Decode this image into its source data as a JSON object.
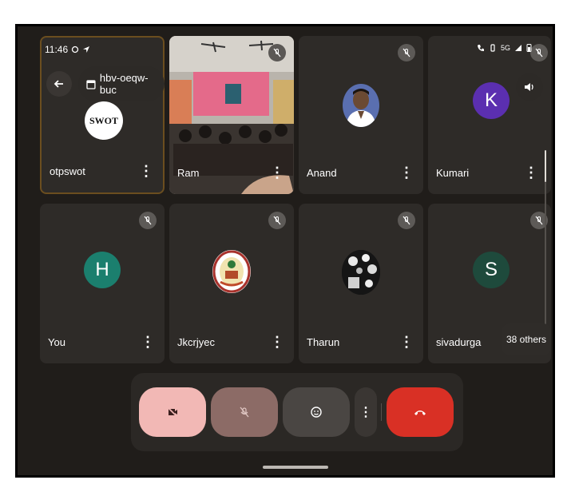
{
  "status_bar": {
    "time": "11:46",
    "icons": [
      "sync-icon",
      "location-icon",
      "wifi-calling-icon",
      "vibrate-icon",
      "volte-icon",
      "5g-icon",
      "signal-icon",
      "battery-icon"
    ],
    "network": "5G"
  },
  "header": {
    "meeting_code": "hbv-oeqw-buc",
    "back_icon": "arrow-back-icon",
    "calendar_icon": "calendar-icon",
    "speaker_icon": "speaker-icon"
  },
  "participants": [
    {
      "name": "otpswot",
      "logo_text": "SWOT",
      "type": "logo",
      "active": true
    },
    {
      "name": "Ram",
      "type": "camera",
      "muted": true
    },
    {
      "name": "Anand",
      "type": "photo",
      "muted": true
    },
    {
      "name": "Kumari",
      "type": "letter",
      "letter": "K",
      "color": "#5b2fb0",
      "muted": true
    },
    {
      "name": "You",
      "type": "letter",
      "letter": "H",
      "color": "#1b7f6e",
      "muted": true
    },
    {
      "name": "Jkcrjyec",
      "type": "logo",
      "muted": true
    },
    {
      "name": "Tharun",
      "type": "photo",
      "muted": true
    },
    {
      "name": "sivadurga",
      "type": "letter",
      "letter": "S",
      "color": "#1e4a3c",
      "muted": true
    }
  ],
  "others_label": "38 others",
  "controls": {
    "camera": {
      "icon": "camera-off-icon",
      "color": "#f2b8b5"
    },
    "mic": {
      "icon": "mic-off-icon",
      "color": "#8c6b66"
    },
    "reactions": {
      "icon": "emoji-icon",
      "color": "#4a4643"
    },
    "more": {
      "icon": "more-vert-icon"
    },
    "hangup": {
      "icon": "call-end-icon",
      "color": "#d93025"
    }
  }
}
